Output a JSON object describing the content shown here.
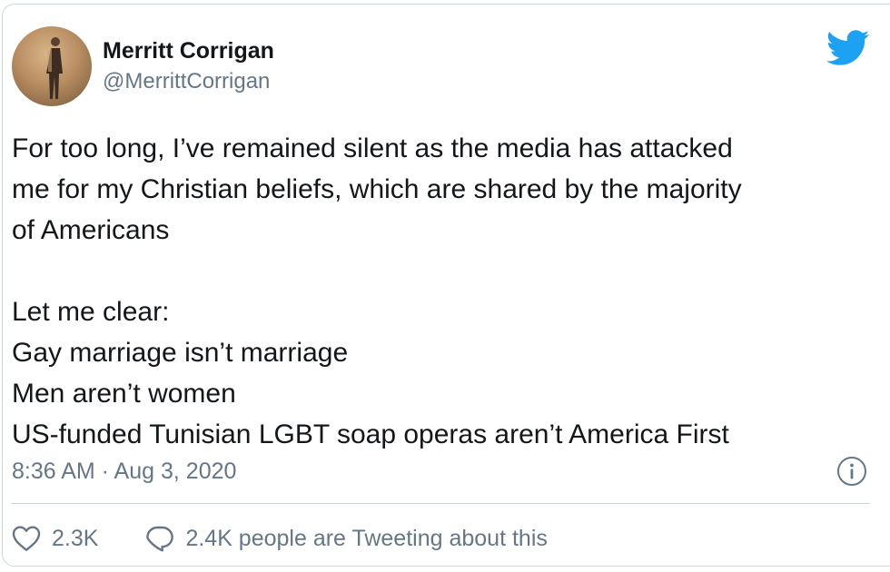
{
  "author": {
    "name": "Merritt Corrigan",
    "handle": "@MerrittCorrigan"
  },
  "tweet": {
    "lines": [
      "For too long, I’ve remained silent as the media has attacked",
      "me for my Christian beliefs, which are shared by the majority",
      "of Americans",
      "",
      "Let me clear:",
      "Gay marriage isn’t marriage",
      "Men aren’t women",
      "US-funded Tunisian LGBT soap operas aren’t America First"
    ],
    "timestamp": "8:36 AM · Aug 3, 2020"
  },
  "actions": {
    "like_count": "2.3K",
    "reply_text": "2.4K people are Tweeting about this"
  },
  "icons": {
    "brand": "twitter-bird-icon",
    "info": "info-icon",
    "like": "heart-icon",
    "reply": "speech-bubble-icon"
  },
  "colors": {
    "brand_blue": "#1da1f2",
    "text_primary": "#14171a",
    "text_secondary": "#657786",
    "border": "#ccd6dd"
  }
}
